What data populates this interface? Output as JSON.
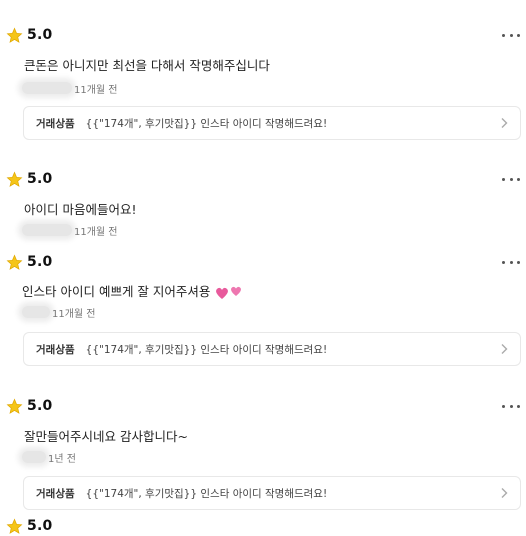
{
  "reviews": [
    {
      "score": "5.0",
      "content": "큰돈은 아니지만 최선을 다해서 작명해주십니다",
      "time": "11개월 전",
      "item": {
        "label": "거래상품",
        "title": "{{\"174개\", 후기맛집}} 인스타 아이디 작명해드려요!"
      }
    },
    {
      "score": "5.0",
      "content": "아이디 마음에들어요!",
      "time": "11개월 전"
    },
    {
      "score": "5.0",
      "content": "인스타 아이디 예쁘게 잘 지어주셔용",
      "time": "11개월 전",
      "item": {
        "label": "거래상품",
        "title": "{{\"174개\", 후기맛집}} 인스타 아이디 작명해드려요!"
      }
    },
    {
      "score": "5.0",
      "content": "잘만들어주시네요 감사합니다~",
      "time": "1년 전",
      "item": {
        "label": "거래상품",
        "title": "{{\"174개\", 후기맛집}} 인스타 아이디 작명해드려요!"
      }
    },
    {
      "score": "5.0"
    }
  ],
  "icons": {
    "star": "star-icon",
    "more": "more-dots-icon",
    "chevron": "chevron-right-icon",
    "emoji": "two-hearts-emoji"
  },
  "colors": {
    "star": "#F5C518",
    "star_outline": "#E0A800",
    "heart": "#E85A9C"
  }
}
